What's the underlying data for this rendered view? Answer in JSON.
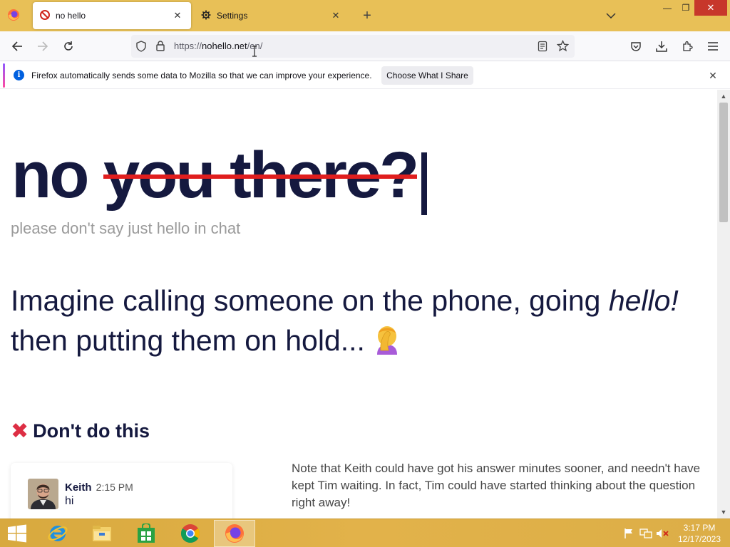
{
  "browser": {
    "tabs": [
      {
        "label": "no hello",
        "active": true
      },
      {
        "label": "Settings",
        "active": false
      }
    ],
    "url": {
      "scheme": "https://",
      "host": "nohello.net",
      "path": "/en/"
    }
  },
  "notification": {
    "text": "Firefox automatically sends some data to Mozilla so that we can improve your experience.",
    "button_label": "Choose What I Share"
  },
  "page": {
    "hero_prefix": "no",
    "hero_struck": "you there?",
    "subtitle": "please don't say just hello in chat",
    "lead_part1": "Imagine calling someone on the phone, going ",
    "lead_emphasis": "hello!",
    "lead_part2": "then putting them on hold...",
    "dont_heading": "Don't do this",
    "chat": {
      "name": "Keith",
      "time": "2:15 PM",
      "message": "hi"
    },
    "note": "Note that Keith could have got his answer minutes sooner, and needn't have kept Tim waiting. In fact, Tim could have started thinking about the question right away!"
  },
  "taskbar": {
    "clock_time": "3:17 PM",
    "clock_date": "12/17/2023"
  },
  "colors": {
    "heading": "#15193f",
    "strike": "#e01e1e",
    "tabbar": "#e8c057",
    "taskbar": "#dcae47"
  }
}
